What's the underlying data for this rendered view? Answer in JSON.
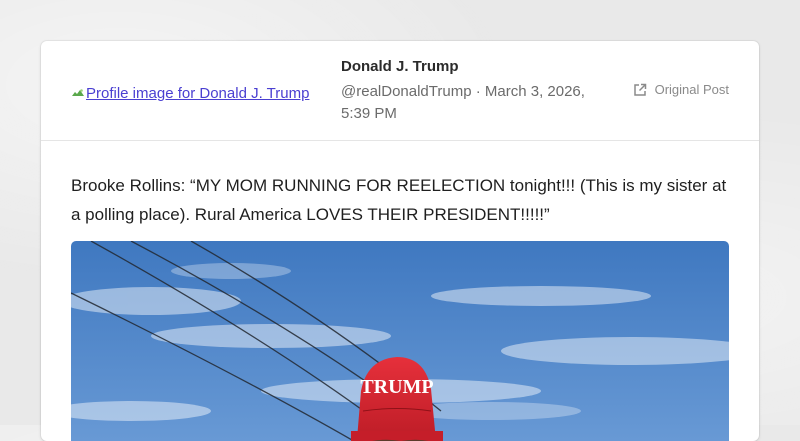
{
  "post": {
    "avatar_alt": "Profile image for Donald J. Trump",
    "author_name": "Donald J. Trump",
    "meta": "@realDonaldTrump · March 3, 2026, 5:39 PM",
    "original_post_label": "Original Post",
    "body_text": "Brooke Rollins: “MY MOM RUNNING FOR REELECTION tonight!!! (This is my sister at a polling place). Rural America LOVES THEIR PRESIDENT!!!!!”",
    "media_hat_text": "TRUMP"
  },
  "icons": {
    "avatar": "broken-image-icon",
    "original_post": "external-link-icon"
  },
  "colors": {
    "link": "#4a3fd1",
    "hat_red": "#d8232f",
    "sky": "#4f86c9"
  }
}
